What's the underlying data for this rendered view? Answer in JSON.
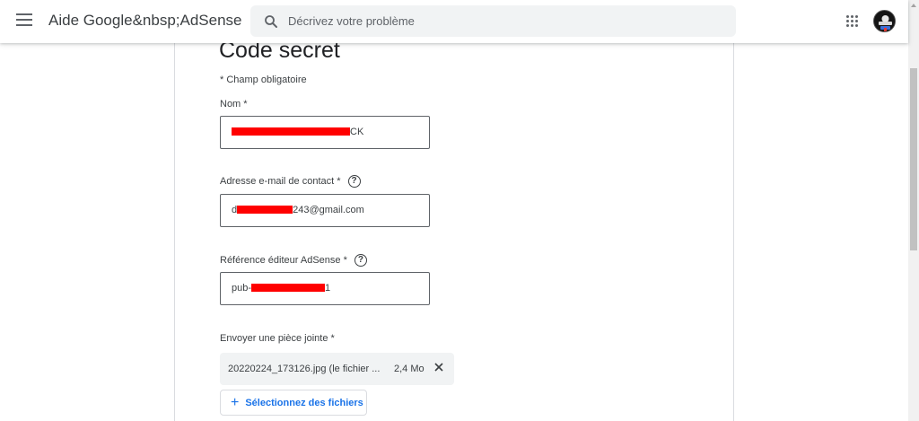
{
  "header": {
    "menu_icon": "hamburger-menu-icon",
    "title": "Aide Google&nbsp;AdSense",
    "search": {
      "placeholder": "Décrivez votre problème",
      "value": "",
      "icon": "search-icon"
    },
    "apps_icon": "apps-grid-icon",
    "avatar_icon": "account-avatar-icon"
  },
  "form": {
    "title": "Code secret",
    "required_note": "* Champ obligatoire",
    "fields": [
      {
        "label": "Nom *",
        "value_visible_suffix": "CK",
        "has_help": false
      },
      {
        "label": "Adresse e-mail de contact *",
        "value_visible_prefix": "d",
        "value_visible_suffix": "243@gmail.com",
        "has_help": true
      },
      {
        "label": "Référence éditeur AdSense *",
        "value_visible_prefix": "pub-",
        "value_visible_suffix": "1",
        "has_help": true
      }
    ],
    "attachment": {
      "label": "Envoyer une pièce jointe *",
      "file_name": "20220224_173126.jpg (le fichier ...",
      "file_size": "2,4 Mo",
      "remove_icon": "close-icon",
      "select_button": "Sélectionnez des fichiers",
      "select_icon": "plus-icon"
    },
    "help_icon_glyph": "?"
  },
  "colors": {
    "accent": "#1a73e8",
    "redaction": "#ff0000",
    "border": "#5f6368"
  }
}
